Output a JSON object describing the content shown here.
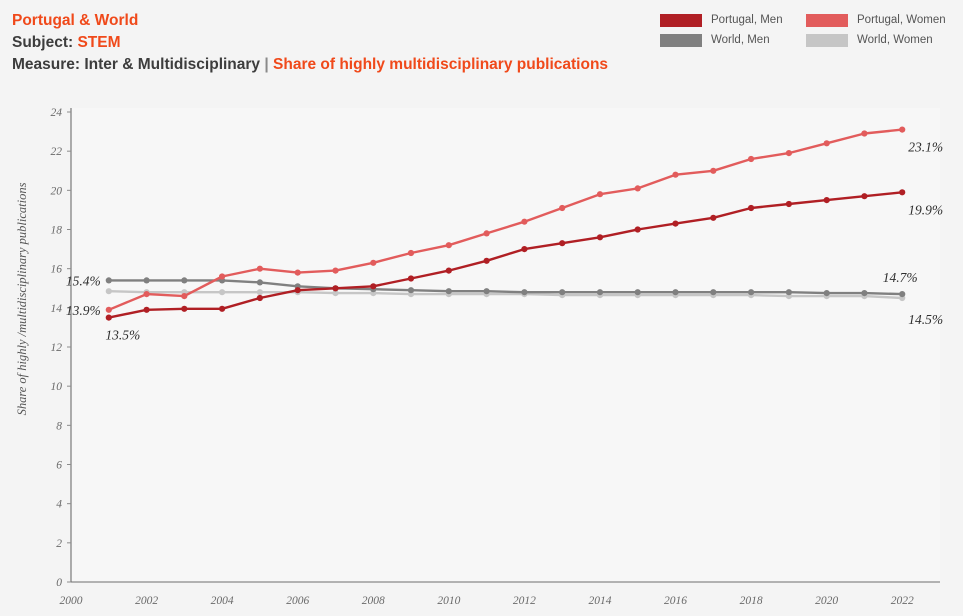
{
  "header": {
    "line1": "Portugal & World",
    "line2_prefix": "Subject: ",
    "line2_value": "STEM",
    "line3_prefix": "Measure: Inter & Multidisciplinary ",
    "line3_sep": "|",
    "line3_value": "Share of highly multidisciplinary publications"
  },
  "legend": {
    "items": [
      {
        "label": "Portugal, Men",
        "color": "#b01f24"
      },
      {
        "label": "Portugal, Women",
        "color": "#e25c5c"
      },
      {
        "label": "World, Men",
        "color": "#808080"
      },
      {
        "label": "World, Women",
        "color": "#c6c6c6"
      }
    ]
  },
  "chart_data": {
    "type": "line",
    "title": "Share of highly multidisciplinary publications",
    "xlabel": "",
    "ylabel": "Share of highly /multidisciplinary publications",
    "xlim": [
      2000,
      2023
    ],
    "ylim": [
      0,
      24
    ],
    "ytick_step": 2,
    "yticks": [
      0,
      2,
      4,
      6,
      8,
      10,
      12,
      14,
      16,
      18,
      20,
      22,
      24
    ],
    "xticks": [
      2000,
      2002,
      2004,
      2006,
      2008,
      2010,
      2012,
      2014,
      2016,
      2018,
      2020,
      2022
    ],
    "grid": false,
    "legend_position": "top-right",
    "x": [
      2001,
      2002,
      2003,
      2004,
      2005,
      2006,
      2007,
      2008,
      2009,
      2010,
      2011,
      2012,
      2013,
      2014,
      2015,
      2016,
      2017,
      2018,
      2019,
      2020,
      2021,
      2022
    ],
    "series": [
      {
        "name": "Portugal, Men",
        "color": "#b01f24",
        "values": [
          13.5,
          13.9,
          13.95,
          13.95,
          14.5,
          14.9,
          15.0,
          15.1,
          15.5,
          15.9,
          16.4,
          17.0,
          17.3,
          17.6,
          18.0,
          18.3,
          18.6,
          19.1,
          19.3,
          19.5,
          19.7,
          19.9
        ],
        "start_label": "13.5%",
        "end_label": "19.9%"
      },
      {
        "name": "Portugal, Women",
        "color": "#e25c5c",
        "values": [
          13.9,
          14.7,
          14.6,
          15.6,
          16.0,
          15.8,
          15.9,
          16.3,
          16.8,
          17.2,
          17.8,
          18.4,
          19.1,
          19.8,
          20.1,
          20.8,
          21.0,
          21.6,
          21.9,
          22.4,
          22.9,
          23.1
        ],
        "start_label": "13.9%",
        "end_label": "23.1%"
      },
      {
        "name": "World, Men",
        "color": "#808080",
        "values": [
          15.4,
          15.4,
          15.4,
          15.4,
          15.3,
          15.1,
          15.0,
          14.95,
          14.9,
          14.85,
          14.85,
          14.8,
          14.8,
          14.8,
          14.8,
          14.8,
          14.8,
          14.8,
          14.8,
          14.75,
          14.75,
          14.7
        ],
        "start_label": "15.4%",
        "end_label": "14.7%"
      },
      {
        "name": "World, Women",
        "color": "#c6c6c6",
        "values": [
          14.85,
          14.8,
          14.8,
          14.8,
          14.8,
          14.8,
          14.75,
          14.75,
          14.7,
          14.7,
          14.7,
          14.7,
          14.65,
          14.65,
          14.65,
          14.65,
          14.65,
          14.65,
          14.6,
          14.6,
          14.6,
          14.5
        ],
        "start_label": "",
        "end_label": "14.5%"
      }
    ],
    "point_labels": {
      "left": [
        {
          "text": "15.4%",
          "series": "World, Men"
        },
        {
          "text": "13.9%",
          "series": "Portugal, Women"
        },
        {
          "text": "13.5%",
          "series": "Portugal, Men"
        }
      ],
      "right": [
        {
          "text": "23.1%",
          "series": "Portugal, Women"
        },
        {
          "text": "19.9%",
          "series": "Portugal, Men"
        },
        {
          "text": "14.7%",
          "series": "World, Men"
        },
        {
          "text": "14.5%",
          "series": "World, Women"
        }
      ]
    }
  }
}
